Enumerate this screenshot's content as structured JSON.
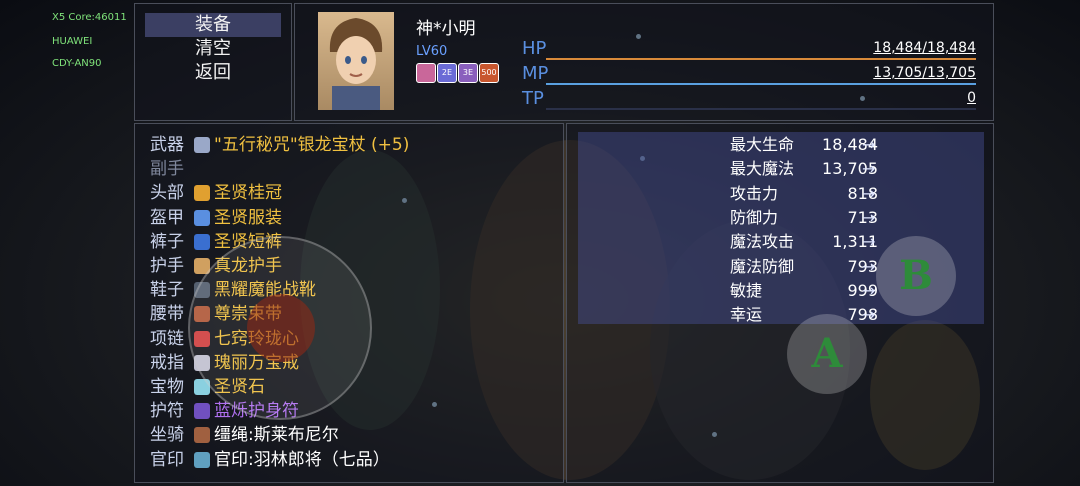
{
  "system_overlay": [
    "X5 Core:46011",
    "HUAWEI",
    "CDY-AN90"
  ],
  "menu": [
    "装备",
    "清空",
    "返回"
  ],
  "character": {
    "name": "神*小明",
    "level_prefix": "LV",
    "level": "60",
    "badges": [
      {
        "label": "",
        "color": "#c9679a",
        "icon": "figure-icon"
      },
      {
        "label": "2E",
        "color": "#6b6bd6",
        "icon": "badge-icon"
      },
      {
        "label": "3E",
        "color": "#8a5fbd",
        "icon": "badge-icon"
      },
      {
        "label": "500",
        "color": "#c8562e",
        "icon": "badge-icon"
      }
    ]
  },
  "bars": [
    {
      "label": "HP",
      "value": "18,484/18,484",
      "color": "#d98a3a",
      "fill": 1.0
    },
    {
      "label": "MP",
      "value": "13,705/13,705",
      "color": "#5aa0e0",
      "fill": 1.0
    },
    {
      "label": "TP",
      "value": "0",
      "color": "#2c3450",
      "fill": 0.0
    }
  ],
  "equipment": [
    {
      "slot": "武器",
      "item": "\"五行秘咒\"银龙宝杖 (+5)",
      "color": "#f0c040",
      "icon_color": "#9aa8c8",
      "icon": "staff-icon"
    },
    {
      "slot": "副手",
      "item": "",
      "color": "#ffffff",
      "icon_color": "",
      "icon": "",
      "dim": true
    },
    {
      "slot": "头部",
      "item": "圣贤桂冠",
      "color": "#f0c040",
      "icon_color": "#e0a030",
      "icon": "crown-icon"
    },
    {
      "slot": "盔甲",
      "item": "圣贤服装",
      "color": "#f0c040",
      "icon_color": "#5a8fe0",
      "icon": "robe-icon"
    },
    {
      "slot": "裤子",
      "item": "圣贤短裤",
      "color": "#f0c040",
      "icon_color": "#3a6fd0",
      "icon": "pants-icon"
    },
    {
      "slot": "护手",
      "item": "真龙护手",
      "color": "#f0c040",
      "icon_color": "#d0a060",
      "icon": "gauntlet-icon"
    },
    {
      "slot": "鞋子",
      "item": "黑耀魔能战靴",
      "color": "#f0c040",
      "icon_color": "#556070",
      "icon": "boots-icon"
    },
    {
      "slot": "腰带",
      "item": "尊崇束带",
      "color": "#f0c040",
      "icon_color": "#b05a3a",
      "icon": "belt-icon"
    },
    {
      "slot": "项链",
      "item": "七窍玲珑心",
      "color": "#f0c040",
      "icon_color": "#d04040",
      "icon": "necklace-icon"
    },
    {
      "slot": "戒指",
      "item": "瑰丽万宝戒",
      "color": "#f0c040",
      "icon_color": "#c0c0d0",
      "icon": "ring-icon"
    },
    {
      "slot": "宝物",
      "item": "圣贤石",
      "color": "#f0c040",
      "icon_color": "#8ad0e0",
      "icon": "gem-icon"
    },
    {
      "slot": "护符",
      "item": "蓝烁护身符",
      "color": "#b070f0",
      "icon_color": "#7050c0",
      "icon": "amulet-icon"
    },
    {
      "slot": "坐骑",
      "item": "缰绳:斯莱布尼尔",
      "color": "#ffffff",
      "icon_color": "#a06040",
      "icon": "rein-icon"
    },
    {
      "slot": "官印",
      "item": "官印:羽林郎将（七品）",
      "color": "#ffffff",
      "icon_color": "#60a0c0",
      "icon": "seal-icon"
    }
  ],
  "stats": [
    {
      "label": "最大生命",
      "value": "18,484"
    },
    {
      "label": "最大魔法",
      "value": "13,705"
    },
    {
      "label": "攻击力",
      "value": "818"
    },
    {
      "label": "防御力",
      "value": "713"
    },
    {
      "label": "魔法攻击",
      "value": "1,311"
    },
    {
      "label": "魔法防御",
      "value": "793"
    },
    {
      "label": "敏捷",
      "value": "999"
    },
    {
      "label": "幸运",
      "value": "798"
    }
  ],
  "arrow_glyph": "→",
  "controls": {
    "a_label": "A",
    "b_label": "B"
  }
}
